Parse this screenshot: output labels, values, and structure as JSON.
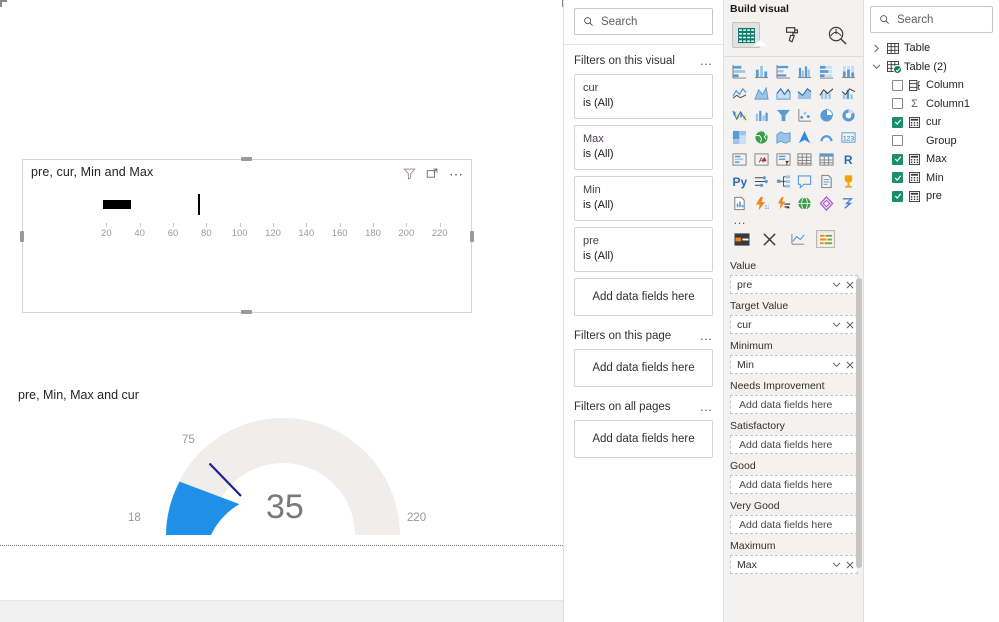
{
  "canvas": {
    "bullet_visual": {
      "title": "pre, cur, Min and Max",
      "header_icons": [
        "filter-icon",
        "focus-mode-icon",
        "more-options-icon"
      ]
    },
    "gauge_visual": {
      "title": "pre, Min, Max and cur",
      "min_label": "18",
      "max_label": "220",
      "target_label": "75",
      "value_label": "35"
    }
  },
  "filters": {
    "search_placeholder": "Search",
    "groups": [
      {
        "title": "Filters on this visual",
        "menu": "…",
        "cards": [
          {
            "name": "cur",
            "value": "is (All)"
          },
          {
            "name": "Max",
            "value": "is (All)"
          },
          {
            "name": "Min",
            "value": "is (All)"
          },
          {
            "name": "pre",
            "value": "is (All)"
          }
        ],
        "dropzone": "Add data fields here"
      },
      {
        "title": "Filters on this page",
        "menu": "…",
        "cards": [],
        "dropzone": "Add data fields here"
      },
      {
        "title": "Filters on all pages",
        "menu": "…",
        "cards": [],
        "dropzone": "Add data fields here"
      }
    ]
  },
  "visualizations": {
    "header": "Build visual",
    "tabs": [
      {
        "name": "build-visual-tab",
        "icon": "table-grid-icon",
        "selected": true
      },
      {
        "name": "format-visual-tab",
        "icon": "paint-roller-icon",
        "selected": false
      },
      {
        "name": "analytics-tab",
        "icon": "magnifier-chart-icon",
        "selected": false
      }
    ],
    "gallery_more": "…",
    "gallery": [
      "stacked-bar-chart-icon",
      "stacked-column-chart-icon",
      "clustered-bar-chart-icon",
      "clustered-column-chart-icon",
      "100-stacked-bar-chart-icon",
      "100-stacked-column-chart-icon",
      "line-chart-icon",
      "area-chart-icon",
      "stacked-area-chart-icon",
      "line-stacked-column-icon",
      "line-clustered-column-icon",
      "ribbon-chart-icon",
      "waterfall-chart-icon",
      "funnel-chart-icon",
      "scatter-chart-icon",
      "pie-chart-icon",
      "donut-chart-icon",
      "treemap-icon",
      "map-icon",
      "filled-map-icon",
      "azure-map-icon",
      "arcgis-map-icon",
      "card-icon",
      "multi-row-card-icon",
      "kpi-icon",
      "slicer-icon",
      "table-icon",
      "matrix-icon",
      "r-script-visual-icon",
      "python-visual-icon",
      "key-influencers-icon",
      "decomposition-tree-icon",
      "qa-visual-icon",
      "smart-narrative-icon",
      "metrics-icon",
      "paginated-report-icon",
      "power-automate-icon",
      "azure-ml-icon",
      "globe-icon",
      "gauge-icon",
      "chart-flow-icon"
    ],
    "tool_row": [
      "format-bar-icon",
      "tools-icon",
      "analytics-pane-icon",
      "gauge-fields-icon"
    ],
    "wells": [
      {
        "label": "Value",
        "field": "pre"
      },
      {
        "label": "Target Value",
        "field": "cur"
      },
      {
        "label": "Minimum",
        "field": "Min"
      },
      {
        "label": "Needs Improvement",
        "field": null,
        "placeholder": "Add data fields here"
      },
      {
        "label": "Satisfactory",
        "field": null,
        "placeholder": "Add data fields here"
      },
      {
        "label": "Good",
        "field": null,
        "placeholder": "Add data fields here"
      },
      {
        "label": "Very Good",
        "field": null,
        "placeholder": "Add data fields here"
      },
      {
        "label": "Maximum",
        "field": "Max"
      }
    ]
  },
  "data_pane": {
    "search_placeholder": "Search",
    "tree": [
      {
        "label": "Table",
        "level": 1,
        "expanded": false,
        "icon": "table-icon",
        "checkbox": null
      },
      {
        "label": "Table (2)",
        "level": 1,
        "expanded": true,
        "icon": "table-checked-icon",
        "checkbox": null
      },
      {
        "label": "Column",
        "level": 2,
        "icon": "group-column-icon",
        "checkbox": false
      },
      {
        "label": "Column1",
        "level": 2,
        "icon": "sigma-icon",
        "checkbox": false
      },
      {
        "label": "cur",
        "level": 2,
        "icon": "measure-icon",
        "checkbox": true
      },
      {
        "label": "Group",
        "level": 2,
        "icon": "none",
        "checkbox": false
      },
      {
        "label": "Max",
        "level": 2,
        "icon": "measure-icon",
        "checkbox": true
      },
      {
        "label": "Min",
        "level": 2,
        "icon": "measure-icon",
        "checkbox": true
      },
      {
        "label": "pre",
        "level": 2,
        "icon": "measure-icon",
        "checkbox": true
      }
    ]
  },
  "colors": {
    "gauge_fill": "#1E90E8",
    "gauge_track": "#EFEEED",
    "gauge_target": "#1F1F8F",
    "bullet_bar": "#000000",
    "accent_check": "#1A8F6B"
  },
  "chart_data": [
    {
      "type": "bar",
      "title": "pre, cur, Min and Max",
      "subtype": "bullet",
      "value": 35,
      "target": 75,
      "minimum": 18,
      "maximum": 220,
      "axis_ticks": [
        20,
        40,
        60,
        80,
        100,
        120,
        140,
        160,
        180,
        200,
        220
      ],
      "xlim": [
        18,
        228
      ],
      "xlabel": "",
      "ylabel": "",
      "grid": false,
      "legend": "none"
    },
    {
      "type": "pie",
      "title": "pre, Min, Max and cur",
      "subtype": "gauge",
      "value": 35,
      "target": 75,
      "minimum": 18,
      "maximum": 220,
      "value_label": "35",
      "min_label": "18",
      "max_label": "220",
      "target_label": "75",
      "grid": false,
      "legend": "none"
    }
  ]
}
